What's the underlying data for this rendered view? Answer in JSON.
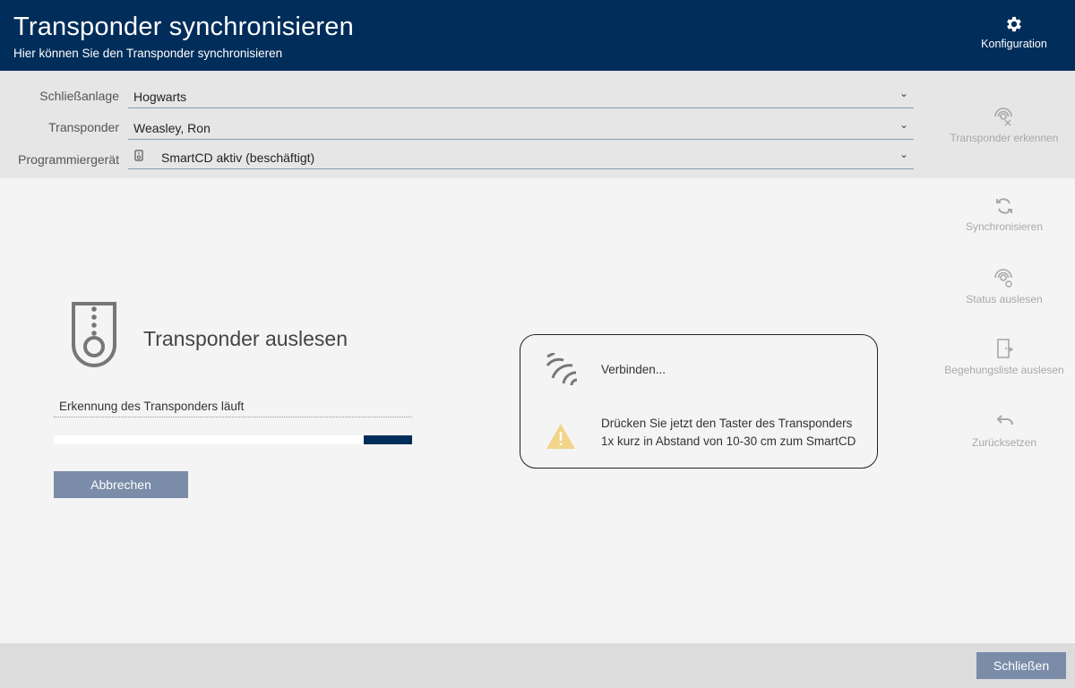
{
  "header": {
    "title": "Transponder synchronisieren",
    "subtitle": "Hier können Sie den Transponder synchronisieren",
    "config_label": "Konfiguration"
  },
  "form": {
    "lock_system_label": "Schließanlage",
    "lock_system_value": "Hogwarts",
    "transponder_label": "Transponder",
    "transponder_value": "Weasley, Ron",
    "programmer_label": "Programmiergerät",
    "programmer_value": "SmartCD aktiv (beschäftigt)"
  },
  "side_actions": {
    "detect": "Transponder erkennen",
    "sync": "Synchronisieren",
    "read_status": "Status auslesen",
    "read_access_list": "Begehungsliste auslesen",
    "reset": "Zurücksetzen"
  },
  "main": {
    "title": "Transponder auslesen",
    "status": "Erkennung des Transponders läuft",
    "progress": {
      "indicator_start": 0.865,
      "indicator_end": 1.0
    },
    "cancel_label": "Abbrechen"
  },
  "info": {
    "connecting": "Verbinden...",
    "instruction_line1": "Drücken Sie jetzt den Taster des Transponders",
    "instruction_line2": "1x kurz in Abstand von 10-30 cm zum SmartCD"
  },
  "footer": {
    "close_label": "Schließen"
  },
  "colors": {
    "header_bg": "#012d5a",
    "button_bg": "#7a8ca8",
    "warning": "#f2d48a",
    "disabled": "#a8a8a8"
  }
}
